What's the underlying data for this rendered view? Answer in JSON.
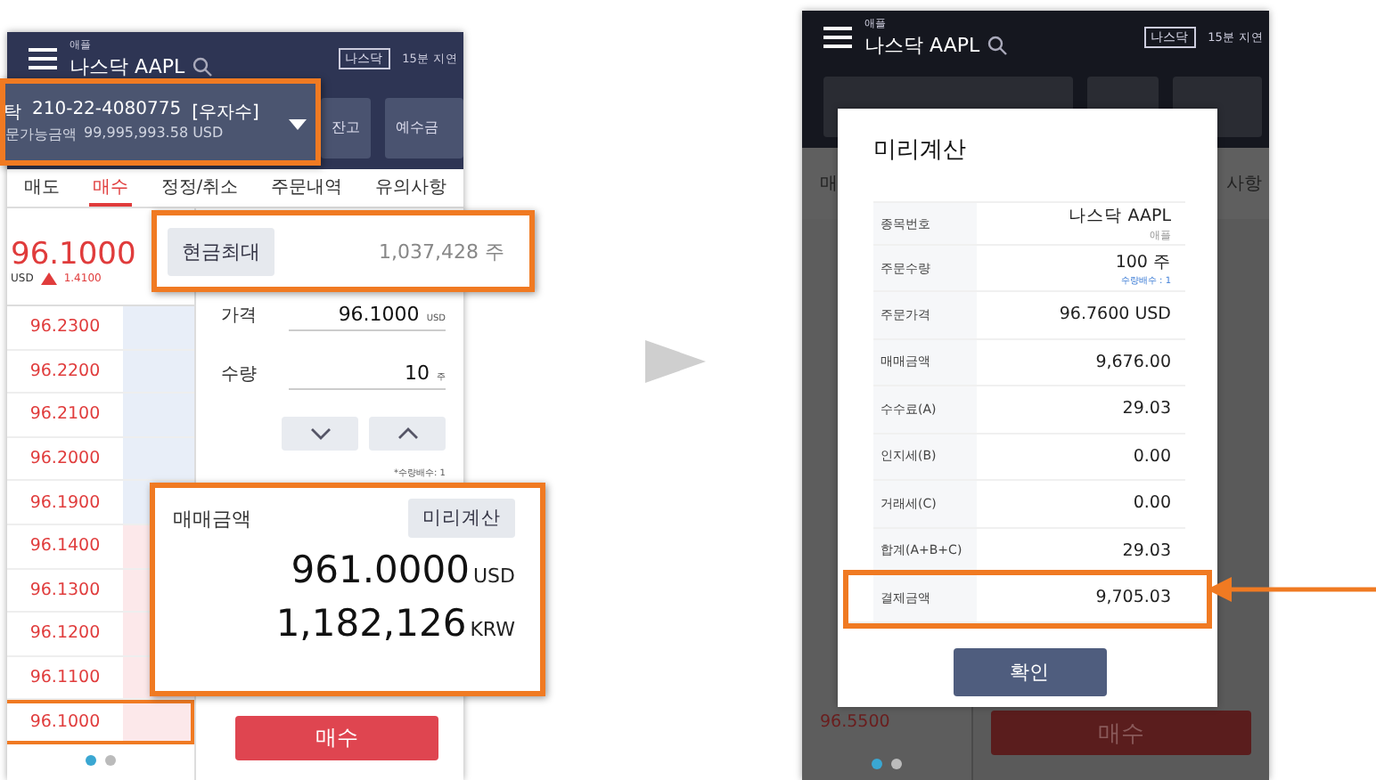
{
  "left_screen": {
    "header": {
      "subtitle": "애플",
      "title": "나스닥 AAPL",
      "market_badge": "나스닥",
      "delay": "15분 지연"
    },
    "account": {
      "type": "탁",
      "number": "210-22-4080775",
      "holder": "[우자수]",
      "available_label": "문가능금액",
      "available": "99,995,993.58 USD"
    },
    "header_buttons": [
      "잔고",
      "예수금"
    ],
    "tabs": [
      {
        "label": "매도",
        "selected": false
      },
      {
        "label": "매수",
        "selected": true
      },
      {
        "label": "정정/취소",
        "selected": false
      },
      {
        "label": "주문내역",
        "selected": false
      },
      {
        "label": "유의사항",
        "selected": false
      }
    ],
    "current_price": {
      "price": "96.1000",
      "currency": "USD",
      "change": "1.4100"
    },
    "order_book": [
      {
        "price": "96.2300",
        "kind": "ask",
        "highlighted": false
      },
      {
        "price": "96.2200",
        "kind": "ask",
        "highlighted": false
      },
      {
        "price": "96.2100",
        "kind": "ask",
        "highlighted": false
      },
      {
        "price": "96.2000",
        "kind": "ask",
        "highlighted": false
      },
      {
        "price": "96.1900",
        "kind": "ask",
        "highlighted": false
      },
      {
        "price": "96.1400",
        "kind": "bid",
        "highlighted": false
      },
      {
        "price": "96.1300",
        "kind": "bid",
        "highlighted": false
      },
      {
        "price": "96.1200",
        "kind": "bid",
        "highlighted": false
      },
      {
        "price": "96.1100",
        "kind": "bid",
        "highlighted": false
      },
      {
        "price": "96.1000",
        "kind": "bid",
        "highlighted": true
      }
    ],
    "max_button": "현금최대",
    "max_quantity": "1,037,428 주",
    "price_field": {
      "label": "가격",
      "value": "96.1000",
      "unit": "USD"
    },
    "quantity_field": {
      "label": "수량",
      "value": "10",
      "unit": "주"
    },
    "multiplier_note": "*수량배수: 1",
    "amount": {
      "label": "매매금액",
      "preview_button": "미리계산",
      "usd": "961.0000",
      "usd_unit": "USD",
      "krw": "1,182,126",
      "krw_unit": "KRW"
    },
    "buy_button": "매수",
    "pager": [
      {
        "selected": true
      },
      {
        "selected": false
      }
    ]
  },
  "right_screen": {
    "header": {
      "subtitle": "애플",
      "title": "나스닥 AAPL",
      "market_badge": "나스닥",
      "delay": "15분 지연"
    },
    "tab_fragments": [
      "매",
      "사항"
    ],
    "order_price": "96.5500",
    "buy_button": "매수",
    "pager": [
      {
        "selected": true
      },
      {
        "selected": false
      }
    ],
    "dialog": {
      "title": "미리계산",
      "rows": [
        {
          "label": "종목번호",
          "value": "나스닥  AAPL",
          "note": "애플",
          "highlighted": false
        },
        {
          "label": "주문수량",
          "value": "100 주",
          "note": "수량배수 : 1",
          "highlighted": false
        },
        {
          "label": "주문가격",
          "value": "96.7600 USD",
          "highlighted": false
        },
        {
          "label": "매매금액",
          "value": "9,676.00",
          "highlighted": false
        },
        {
          "label": "수수료(A)",
          "value": "29.03",
          "highlighted": false
        },
        {
          "label": "인지세(B)",
          "value": "0.00",
          "highlighted": false
        },
        {
          "label": "거래세(C)",
          "value": "0.00",
          "highlighted": false
        },
        {
          "label": "합계(A+B+C)",
          "value": "29.03",
          "highlighted": false
        },
        {
          "label": "결제금액",
          "value": "9,705.03",
          "highlighted": true
        }
      ],
      "confirm_button": "확인"
    }
  }
}
